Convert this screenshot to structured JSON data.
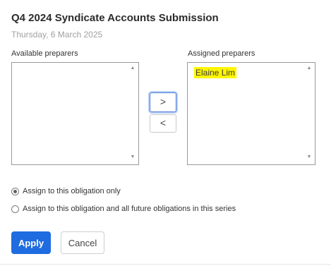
{
  "dialog": {
    "title": "Q4 2024 Syndicate Accounts Submission",
    "date": "Thursday, 6 March 2025"
  },
  "available": {
    "label": "Available preparers",
    "items": []
  },
  "assigned": {
    "label": "Assigned preparers",
    "items": [
      "Elaine Lim"
    ],
    "highlight_color": "#fff700"
  },
  "move": {
    "right_symbol": ">",
    "left_symbol": "<"
  },
  "scope": {
    "options": [
      {
        "label": "Assign to this obligation only",
        "selected": true
      },
      {
        "label": "Assign to this obligation and all future obligations in this series",
        "selected": false
      }
    ]
  },
  "actions": {
    "apply_label": "Apply",
    "cancel_label": "Cancel",
    "apply_color": "#1f6be0"
  }
}
